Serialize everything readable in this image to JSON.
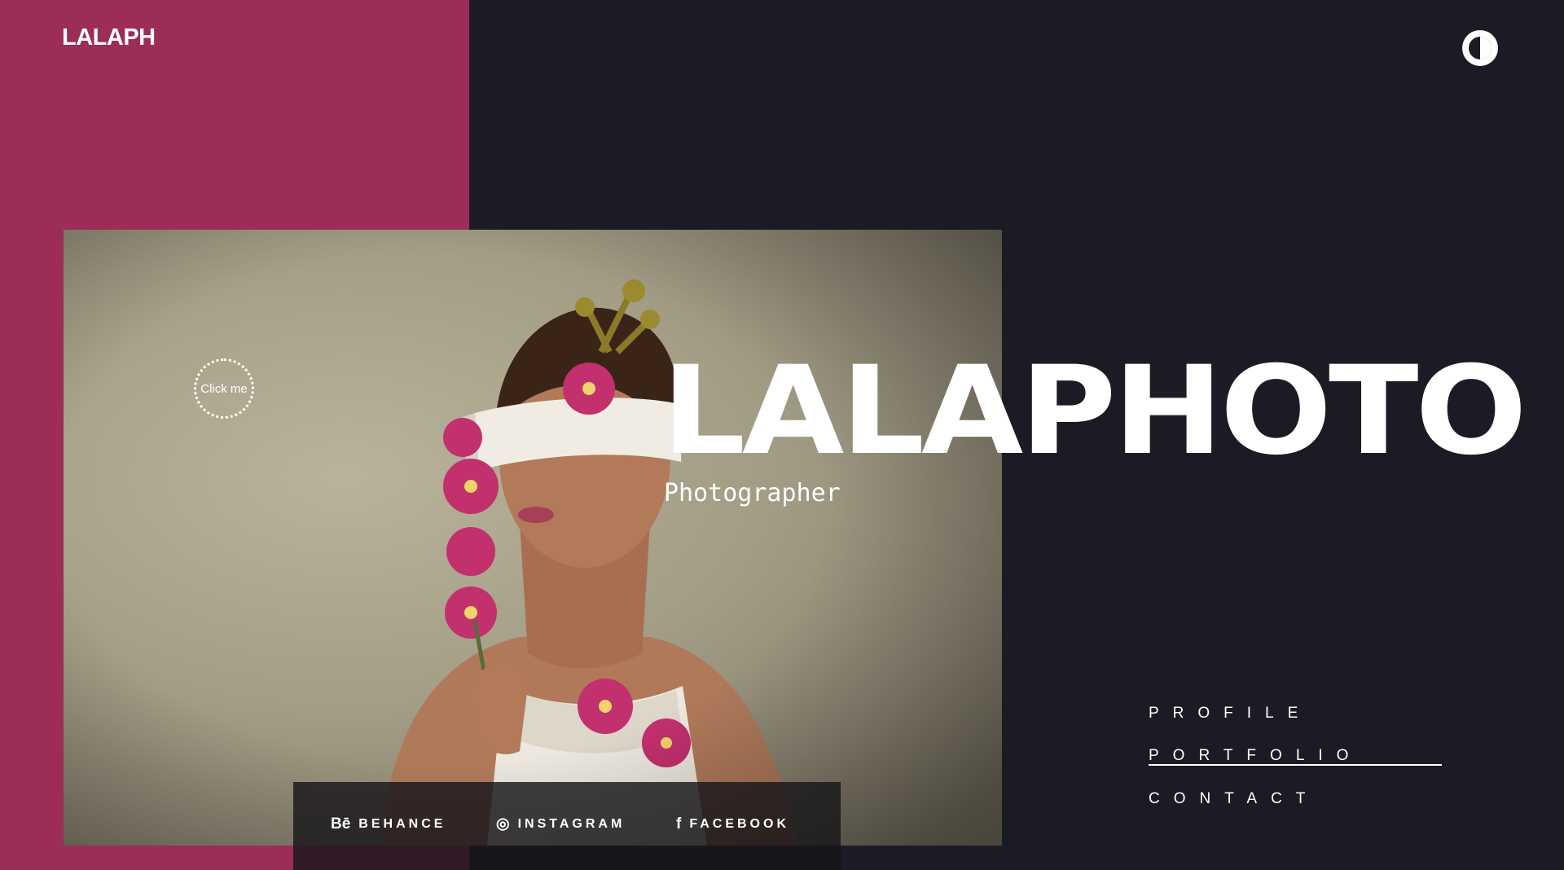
{
  "brand": {
    "logo": "LALAPH"
  },
  "colors": {
    "accent_pink": "#9b2d58",
    "background": "#1a1b24",
    "text": "#ffffff"
  },
  "theme_toggle": {
    "icon": "contrast-icon"
  },
  "hero": {
    "title": "LALAPHOTO",
    "subtitle": "Photographer",
    "click_me": "Click me"
  },
  "social": [
    {
      "icon": "behance-icon",
      "glyph": "Bē",
      "label": "BEHANCE"
    },
    {
      "icon": "instagram-icon",
      "glyph": "◎",
      "label": "INSTAGRAM"
    },
    {
      "icon": "facebook-icon",
      "glyph": "f",
      "label": "FACEBOOK"
    }
  ],
  "nav": {
    "items": [
      {
        "label": "PROFILE",
        "active": false
      },
      {
        "label": "PORTFOLIO",
        "active": true
      },
      {
        "label": "CONTACT",
        "active": false
      }
    ]
  }
}
